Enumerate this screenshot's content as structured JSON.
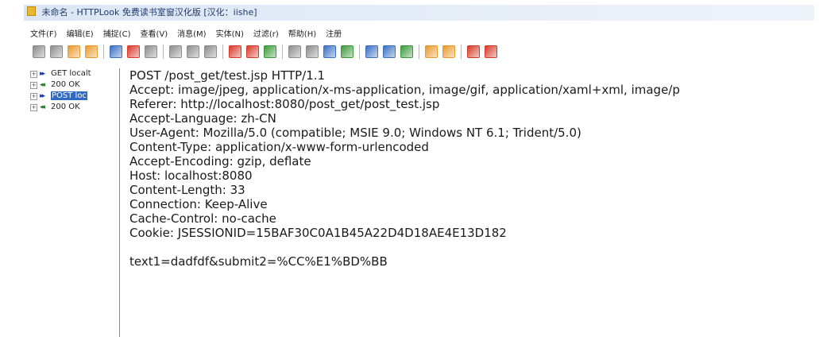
{
  "window": {
    "title": "未命名 - HTTPLook 免费读书室窗汉化版 [汉化：iishe]"
  },
  "menu": {
    "items": [
      "文件(F)",
      "编辑(E)",
      "捕捉(C)",
      "查看(V)",
      "消息(M)",
      "实体(N)",
      "过滤(r)",
      "帮助(H)",
      "注册"
    ]
  },
  "toolbar": {
    "groups": [
      [
        "app-icon",
        "new-icon",
        "open-icon",
        "save-icon"
      ],
      [
        "start-capture-icon",
        "stop-capture-icon",
        "clear-icon"
      ],
      [
        "copy-icon",
        "find-icon",
        "find-next-icon"
      ],
      [
        "delete-icon",
        "delete-all-icon",
        "refresh-icon"
      ],
      [
        "view-icon",
        "dropdown-icon",
        "filter-icon",
        "edit-icon"
      ],
      [
        "back-icon",
        "forward-icon",
        "properties-icon"
      ],
      [
        "download-icon",
        "stats-icon"
      ],
      [
        "settings-icon",
        "exit-icon"
      ]
    ],
    "colors": {
      "blue": "#3a6fc4",
      "red": "#d63b2a",
      "orange": "#e89a2c",
      "green": "#3c9a3c",
      "gray": "#8c8c8c"
    }
  },
  "tree": {
    "nodes": [
      {
        "arrow": "▸▸",
        "direction": "out",
        "label": "GET localt",
        "selected": false
      },
      {
        "arrow": "◂◂",
        "direction": "in",
        "label": "200 OK",
        "selected": false
      },
      {
        "arrow": "▸▸",
        "direction": "out",
        "label": "POST loc",
        "selected": true
      },
      {
        "arrow": "◂◂",
        "direction": "in",
        "label": "200 OK",
        "selected": false
      }
    ]
  },
  "content": {
    "lines": [
      "POST /post_get/test.jsp HTTP/1.1",
      "Accept: image/jpeg, application/x-ms-application, image/gif, application/xaml+xml, image/p",
      "Referer: http://localhost:8080/post_get/post_test.jsp",
      "Accept-Language: zh-CN",
      "User-Agent: Mozilla/5.0 (compatible; MSIE 9.0; Windows NT 6.1; Trident/5.0)",
      "Content-Type: application/x-www-form-urlencoded",
      "Accept-Encoding: gzip, deflate",
      "Host: localhost:8080",
      "Content-Length: 33",
      "Connection: Keep-Alive",
      "Cache-Control: no-cache",
      "Cookie: JSESSIONID=15BAF30C0A1B45A22D4D18AE4E13D182",
      "",
      "text1=dadfdf&submit2=%CC%E1%BD%BB"
    ]
  }
}
